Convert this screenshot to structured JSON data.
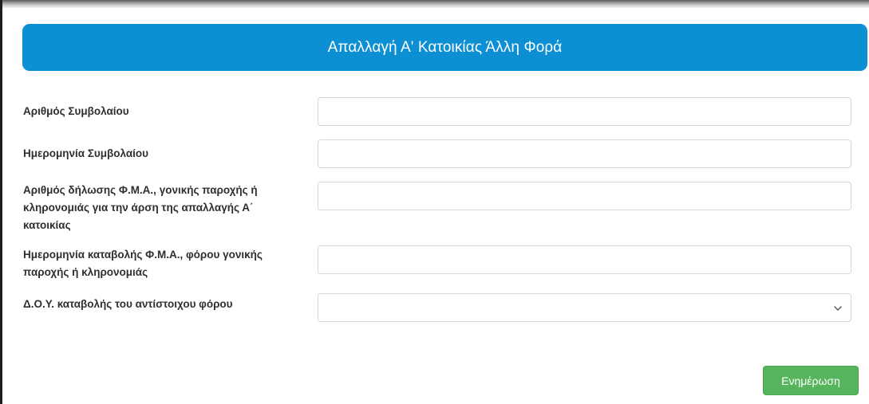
{
  "modal": {
    "title": "Απαλλαγή Α' Κατοικίας Άλλη Φορά"
  },
  "form": {
    "contract_number": {
      "label": "Αριθμός Συμβολαίου",
      "value": "",
      "placeholder": ""
    },
    "contract_date": {
      "label": "Ημερομηνία Συμβολαίου",
      "value": "",
      "placeholder": ""
    },
    "declaration_number": {
      "label": "Αριθμός δήλωσης Φ.Μ.Α., γονικής παροχής ή κληρονομιάς για την άρση της απαλλαγής Α΄ κατοικίας",
      "value": "",
      "placeholder": ""
    },
    "payment_date": {
      "label": "Ημερομηνία καταβολής Φ.Μ.Α., φόρου γονικής παροχής ή κληρονομιάς",
      "value": "",
      "placeholder": ""
    },
    "tax_office": {
      "label": "Δ.Ο.Υ. καταβολής του αντίστοιχου φόρου",
      "selected": ""
    }
  },
  "actions": {
    "update_label": "Ενημέρωση"
  },
  "colors": {
    "header_bg": "#0d8fd3",
    "button_bg": "#56b45c"
  },
  "icons": {
    "select_arrow": "chevron-down-icon"
  }
}
